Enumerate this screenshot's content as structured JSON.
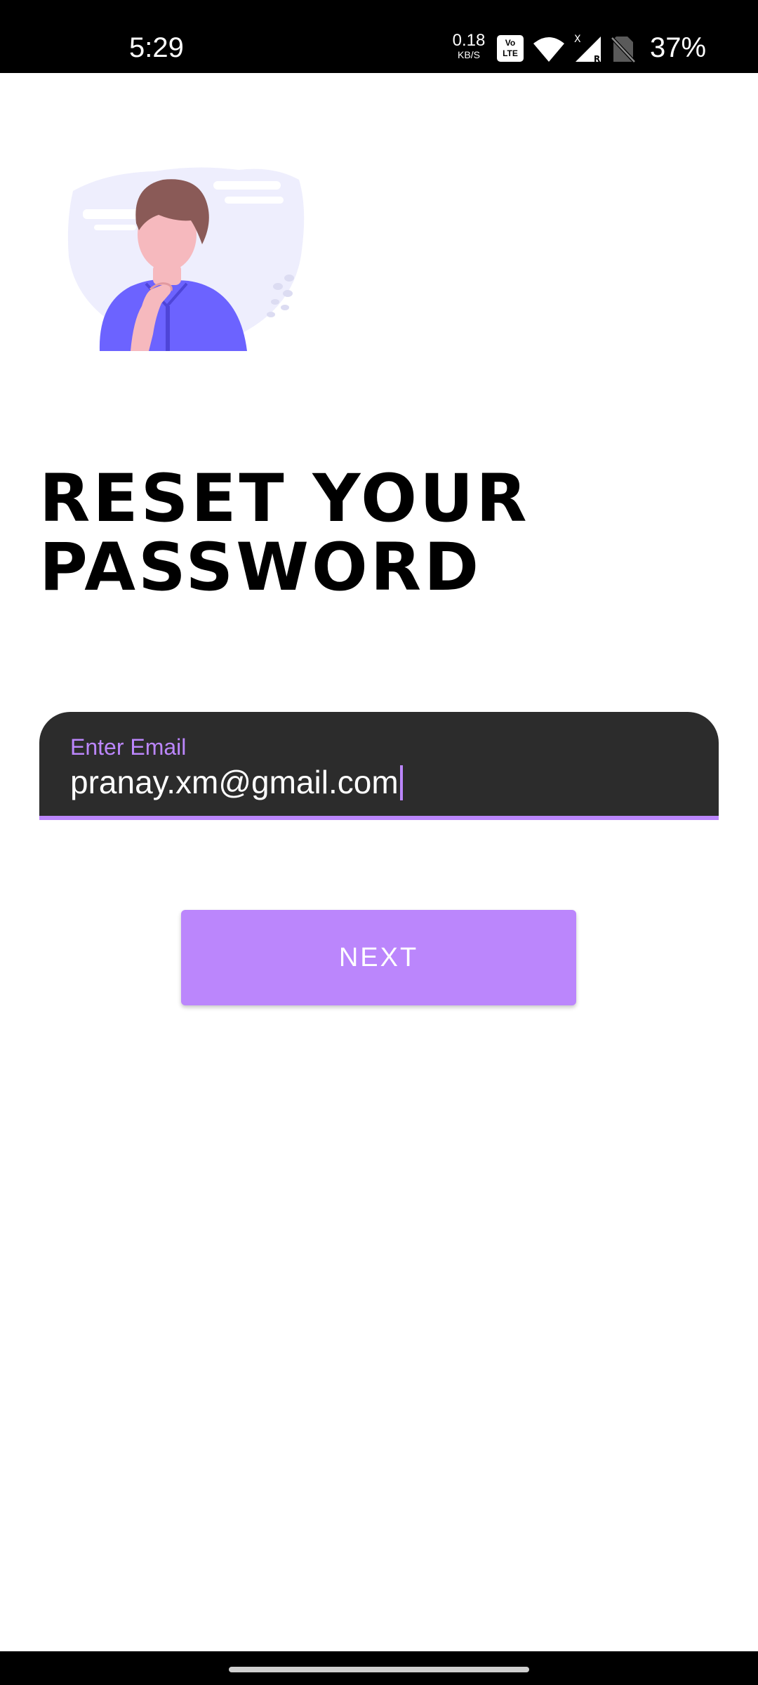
{
  "status_bar": {
    "time": "5:29",
    "net_speed_value": "0.18",
    "net_speed_unit": "KB/S",
    "volte_icon": "volte-icon",
    "volte_label_top": "Vo",
    "volte_label_bottom": "LTE",
    "wifi_icon": "wifi-icon",
    "signal_icon": "signal-icon",
    "no_sim_icon": "no-sim-icon",
    "battery": "37%"
  },
  "illustration": {
    "icon": "person-thinking-illustration",
    "colors": {
      "shirt": "#6c63ff",
      "skin": "#f6b9be",
      "hair": "#8a5a57",
      "background_blob": "#eeeefd"
    }
  },
  "title": {
    "line1": "RESET YOUR",
    "line2": "PASSWORD"
  },
  "email": {
    "label": "Enter Email",
    "value": "pranay.xm@gmail.com"
  },
  "next_button": {
    "label": "NEXT"
  },
  "colors": {
    "accent": "#bb86fc",
    "field_background": "#2c2c2c",
    "status_bar": "#000000",
    "background": "#ffffff"
  }
}
